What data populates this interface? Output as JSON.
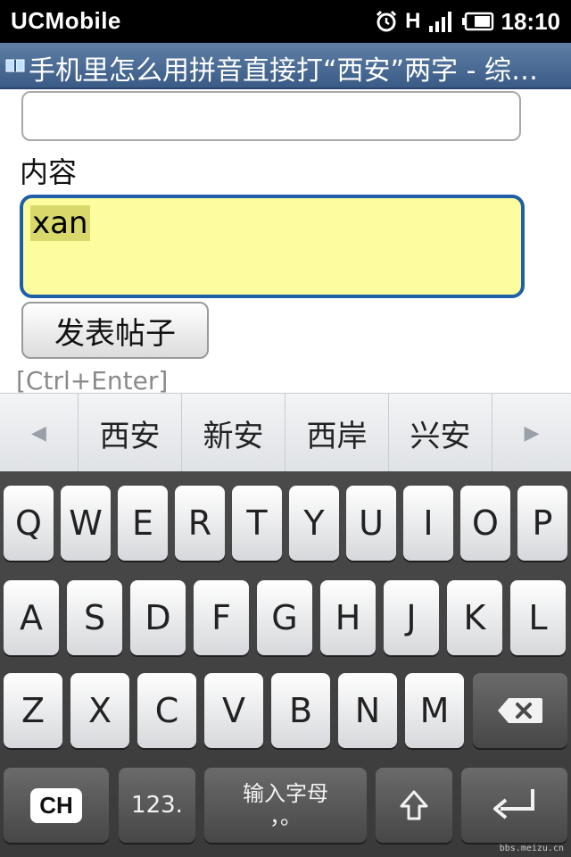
{
  "status": {
    "app_name": "UCMobile",
    "network": "H",
    "time": "18:10"
  },
  "browser": {
    "title": "手机里怎么用拼音直接打“西安”两字 - 综…"
  },
  "form": {
    "content_label": "内容",
    "textarea_value": "xan",
    "submit_label": "发表帖子",
    "shortcut_hint": "[Ctrl+Enter]"
  },
  "candidates": {
    "prev": "◀",
    "items": [
      "西安",
      "新安",
      "西岸",
      "兴安"
    ],
    "next": "▶"
  },
  "keyboard": {
    "row1": [
      "Q",
      "W",
      "E",
      "R",
      "T",
      "Y",
      "U",
      "I",
      "O",
      "P"
    ],
    "row2": [
      "A",
      "S",
      "D",
      "F",
      "G",
      "H",
      "J",
      "K",
      "L"
    ],
    "row3": [
      "Z",
      "X",
      "C",
      "V",
      "B",
      "N",
      "M"
    ],
    "lang": "CH",
    "num": "123.",
    "space_top": "输入字母",
    "space_bottom": "，。"
  },
  "watermark": "bbs.meizu.cn",
  "colors": {
    "accent": "#1f5fa8",
    "textarea_bg": "#fdfd9f",
    "titlebar": "#3a5b86"
  }
}
